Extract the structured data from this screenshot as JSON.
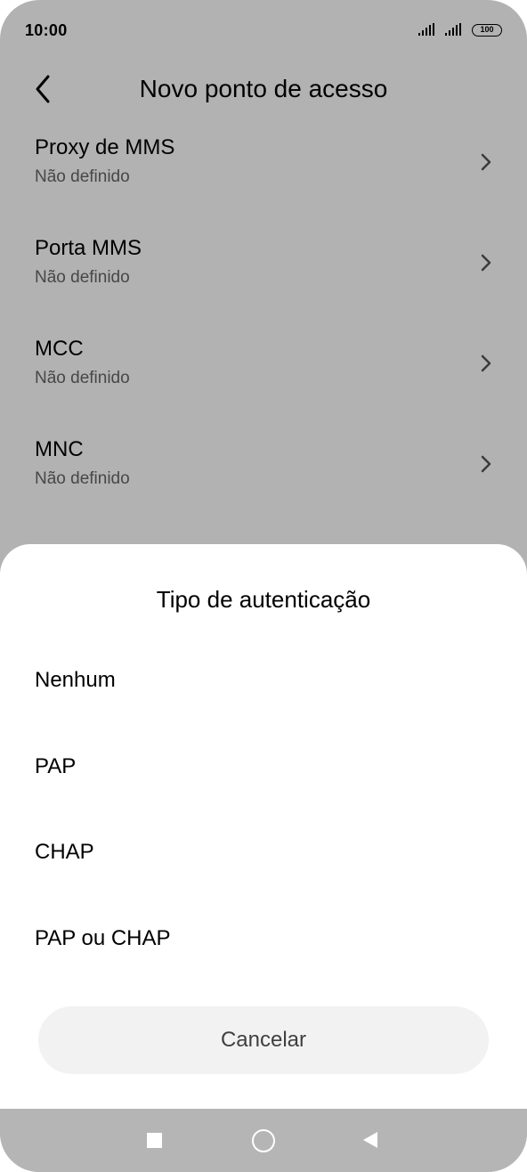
{
  "status_bar": {
    "time": "10:00",
    "battery": "100"
  },
  "header": {
    "title": "Novo ponto de acesso"
  },
  "settings_list": [
    {
      "title": "Proxy de MMS",
      "value": "Não definido"
    },
    {
      "title": "Porta MMS",
      "value": "Não definido"
    },
    {
      "title": "MCC",
      "value": "Não definido"
    },
    {
      "title": "MNC",
      "value": "Não definido"
    }
  ],
  "dialog": {
    "title": "Tipo de autenticação",
    "options": [
      "Nenhum",
      "PAP",
      "CHAP",
      "PAP ou CHAP"
    ],
    "cancel_label": "Cancelar"
  }
}
